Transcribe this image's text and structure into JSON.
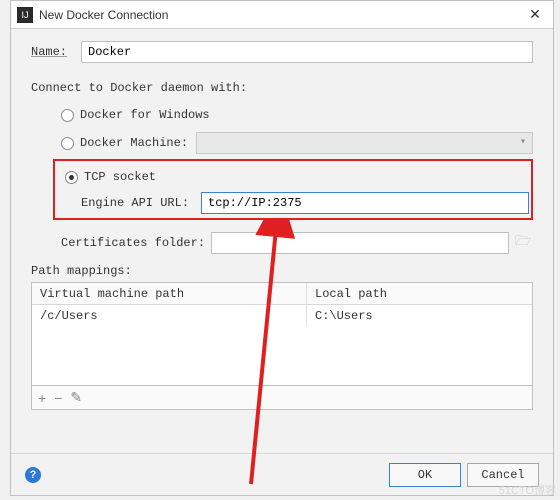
{
  "dialog": {
    "title": "New Docker Connection",
    "app_icon_text": "IJ",
    "close_glyph": "✕"
  },
  "name": {
    "label": "Name:",
    "value": "Docker"
  },
  "connect_label": "Connect to Docker daemon with:",
  "radios": {
    "windows": "Docker for Windows",
    "machine": "Docker Machine:",
    "tcp": "TCP socket"
  },
  "engine_url": {
    "label": "Engine API URL:",
    "value": "tcp://IP:2375"
  },
  "certs": {
    "label": "Certificates folder:",
    "value": ""
  },
  "path_label": "Path mappings:",
  "table": {
    "headers": {
      "vm": "Virtual machine path",
      "local": "Local path"
    },
    "rows": [
      {
        "vm": "/c/Users",
        "local": "C:\\Users"
      }
    ]
  },
  "toolbar": {
    "add": "+",
    "remove": "−",
    "edit": "✎"
  },
  "footer": {
    "help": "?",
    "ok": "OK",
    "cancel": "Cancel"
  },
  "watermark": "51CTO博客"
}
